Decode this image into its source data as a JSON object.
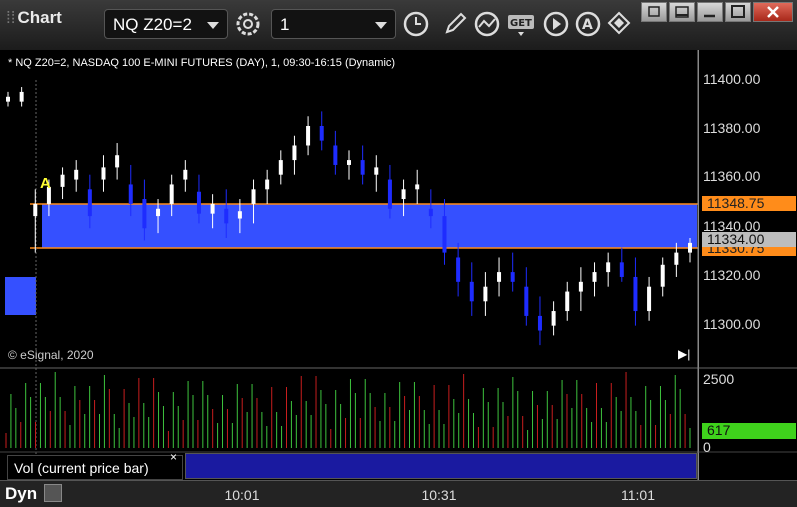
{
  "app": {
    "title": "Chart"
  },
  "toolbar": {
    "symbol": "NQ Z20=2",
    "interval": "1",
    "icons": [
      "gear-icon",
      "clock-icon",
      "pencil-icon",
      "study-icon",
      "get-icon",
      "play-icon",
      "alert-icon",
      "cursor-icon"
    ]
  },
  "window": {
    "controls": [
      "restore",
      "minimize",
      "maximize",
      "close"
    ]
  },
  "chart": {
    "symbol_info": "* NQ Z20=2, NASDAQ 100 E-MINI FUTURES (DAY), 1, 09:30-16:15 (Dynamic)",
    "copyright": "© eSignal, 2020",
    "annotation": "A",
    "price_axis": [
      "11400.00",
      "11380.00",
      "11360.00",
      "11340.00",
      "11320.00",
      "11300.00"
    ],
    "price_levels": {
      "upper": "11348.75",
      "last": "11334.00",
      "lower": "11330.75"
    },
    "volume_axis": {
      "top": "2500",
      "current": "617",
      "bottom": "0"
    },
    "time_axis": [
      "10:01",
      "10:31",
      "11:01"
    ],
    "colors": {
      "band": "#3550ff",
      "band_line": "#ff8c1a",
      "up_bar": "#ffffff",
      "down_bar": "#1e2cff",
      "vol_up": "#3ec43e",
      "vol_down": "#c81e1e",
      "current_vol": "#3fd21c"
    }
  },
  "volume_pane": {
    "label": "Vol (current price bar)",
    "close": "×"
  },
  "status": {
    "mode": "Dyn"
  },
  "chart_data": {
    "type": "table",
    "price_axis_range": [
      11290,
      11405
    ],
    "time_axis_labels": [
      "10:01",
      "10:31",
      "11:01"
    ],
    "highlight_band": [
      11330.75,
      11348.75
    ],
    "last_price": 11334.0,
    "candles_approx": [
      [
        11392,
        11396,
        11390,
        11394
      ],
      [
        11392,
        11398,
        11390,
        11396
      ],
      [
        11345,
        11356,
        11330,
        11350
      ],
      [
        11350,
        11360,
        11345,
        11357
      ],
      [
        11357,
        11365,
        11352,
        11362
      ],
      [
        11360,
        11368,
        11355,
        11364
      ],
      [
        11356,
        11362,
        11340,
        11345
      ],
      [
        11360,
        11370,
        11355,
        11365
      ],
      [
        11365,
        11375,
        11360,
        11370
      ],
      [
        11358,
        11366,
        11345,
        11350
      ],
      [
        11352,
        11360,
        11335,
        11340
      ],
      [
        11345,
        11352,
        11338,
        11348
      ],
      [
        11350,
        11362,
        11345,
        11358
      ],
      [
        11360,
        11368,
        11355,
        11364
      ],
      [
        11355,
        11362,
        11342,
        11346
      ],
      [
        11346,
        11354,
        11340,
        11350
      ],
      [
        11348,
        11356,
        11336,
        11342
      ],
      [
        11344,
        11352,
        11338,
        11347
      ],
      [
        11350,
        11360,
        11342,
        11356
      ],
      [
        11356,
        11364,
        11350,
        11360
      ],
      [
        11362,
        11372,
        11358,
        11368
      ],
      [
        11368,
        11378,
        11362,
        11374
      ],
      [
        11374,
        11386,
        11370,
        11382
      ],
      [
        11382,
        11388,
        11372,
        11376
      ],
      [
        11374,
        11380,
        11362,
        11366
      ],
      [
        11366,
        11372,
        11360,
        11368
      ],
      [
        11368,
        11374,
        11358,
        11362
      ],
      [
        11362,
        11370,
        11355,
        11365
      ],
      [
        11360,
        11366,
        11344,
        11348
      ],
      [
        11352,
        11360,
        11345,
        11356
      ],
      [
        11356,
        11364,
        11350,
        11358
      ],
      [
        11348,
        11356,
        11340,
        11345
      ],
      [
        11345,
        11352,
        11325,
        11330
      ],
      [
        11328,
        11334,
        11312,
        11318
      ],
      [
        11318,
        11326,
        11304,
        11310
      ],
      [
        11310,
        11322,
        11304,
        11316
      ],
      [
        11318,
        11328,
        11312,
        11322
      ],
      [
        11322,
        11330,
        11314,
        11318
      ],
      [
        11316,
        11324,
        11300,
        11304
      ],
      [
        11304,
        11312,
        11292,
        11298
      ],
      [
        11300,
        11310,
        11296,
        11306
      ],
      [
        11306,
        11318,
        11302,
        11314
      ],
      [
        11314,
        11324,
        11306,
        11318
      ],
      [
        11318,
        11326,
        11312,
        11322
      ],
      [
        11322,
        11330,
        11316,
        11326
      ],
      [
        11326,
        11332,
        11318,
        11320
      ],
      [
        11320,
        11328,
        11300,
        11306
      ],
      [
        11306,
        11320,
        11302,
        11316
      ],
      [
        11316,
        11328,
        11312,
        11325
      ],
      [
        11325,
        11334,
        11320,
        11330
      ],
      [
        11330,
        11336,
        11326,
        11334
      ]
    ]
  }
}
